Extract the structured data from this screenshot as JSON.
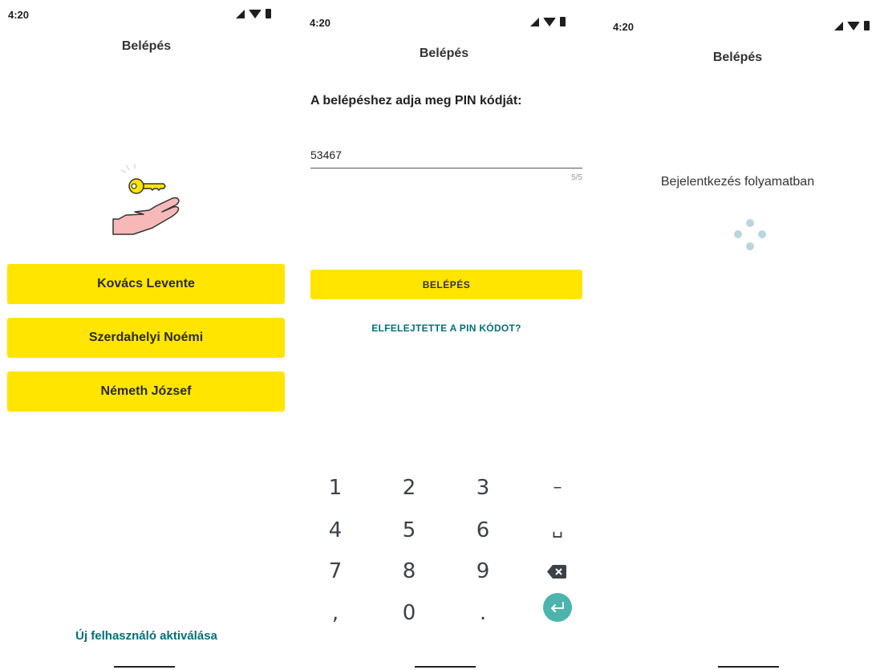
{
  "status_bar": {
    "time": "4:20"
  },
  "screen1": {
    "title": "Belépés",
    "users": [
      "Kovács Levente",
      "Szerdahelyi Noémi",
      "Németh József"
    ],
    "activate_link": "Új felhasználó aktiválása"
  },
  "screen2": {
    "title": "Belépés",
    "prompt": "A belépéshez adja meg PIN kódját:",
    "pin_value": "53467",
    "char_counter": "5/5",
    "login_button": "BELÉPÉS",
    "forgot_pin_link": "ELFELEJTETTE A PIN KÓDOT?",
    "keypad": {
      "k1": "1",
      "k2": "2",
      "k3": "3",
      "dash": "–",
      "k4": "4",
      "k5": "5",
      "k6": "6",
      "space": "␣",
      "k7": "7",
      "k8": "8",
      "k9": "9",
      "comma": ",",
      "k0": "0",
      "dot": "."
    }
  },
  "screen3": {
    "title": "Belépés",
    "status_text": "Bejelentkezés folyamatban"
  },
  "colors": {
    "accent_yellow": "#ffe500",
    "link_teal": "#006f7a",
    "enter_key": "#4bb5ad",
    "spinner": "#b9d6dd"
  },
  "icons": [
    "signal-icon",
    "wifi-icon",
    "battery-icon",
    "key-hand-icon",
    "backspace-icon",
    "enter-icon",
    "loading-spinner-icon"
  ]
}
